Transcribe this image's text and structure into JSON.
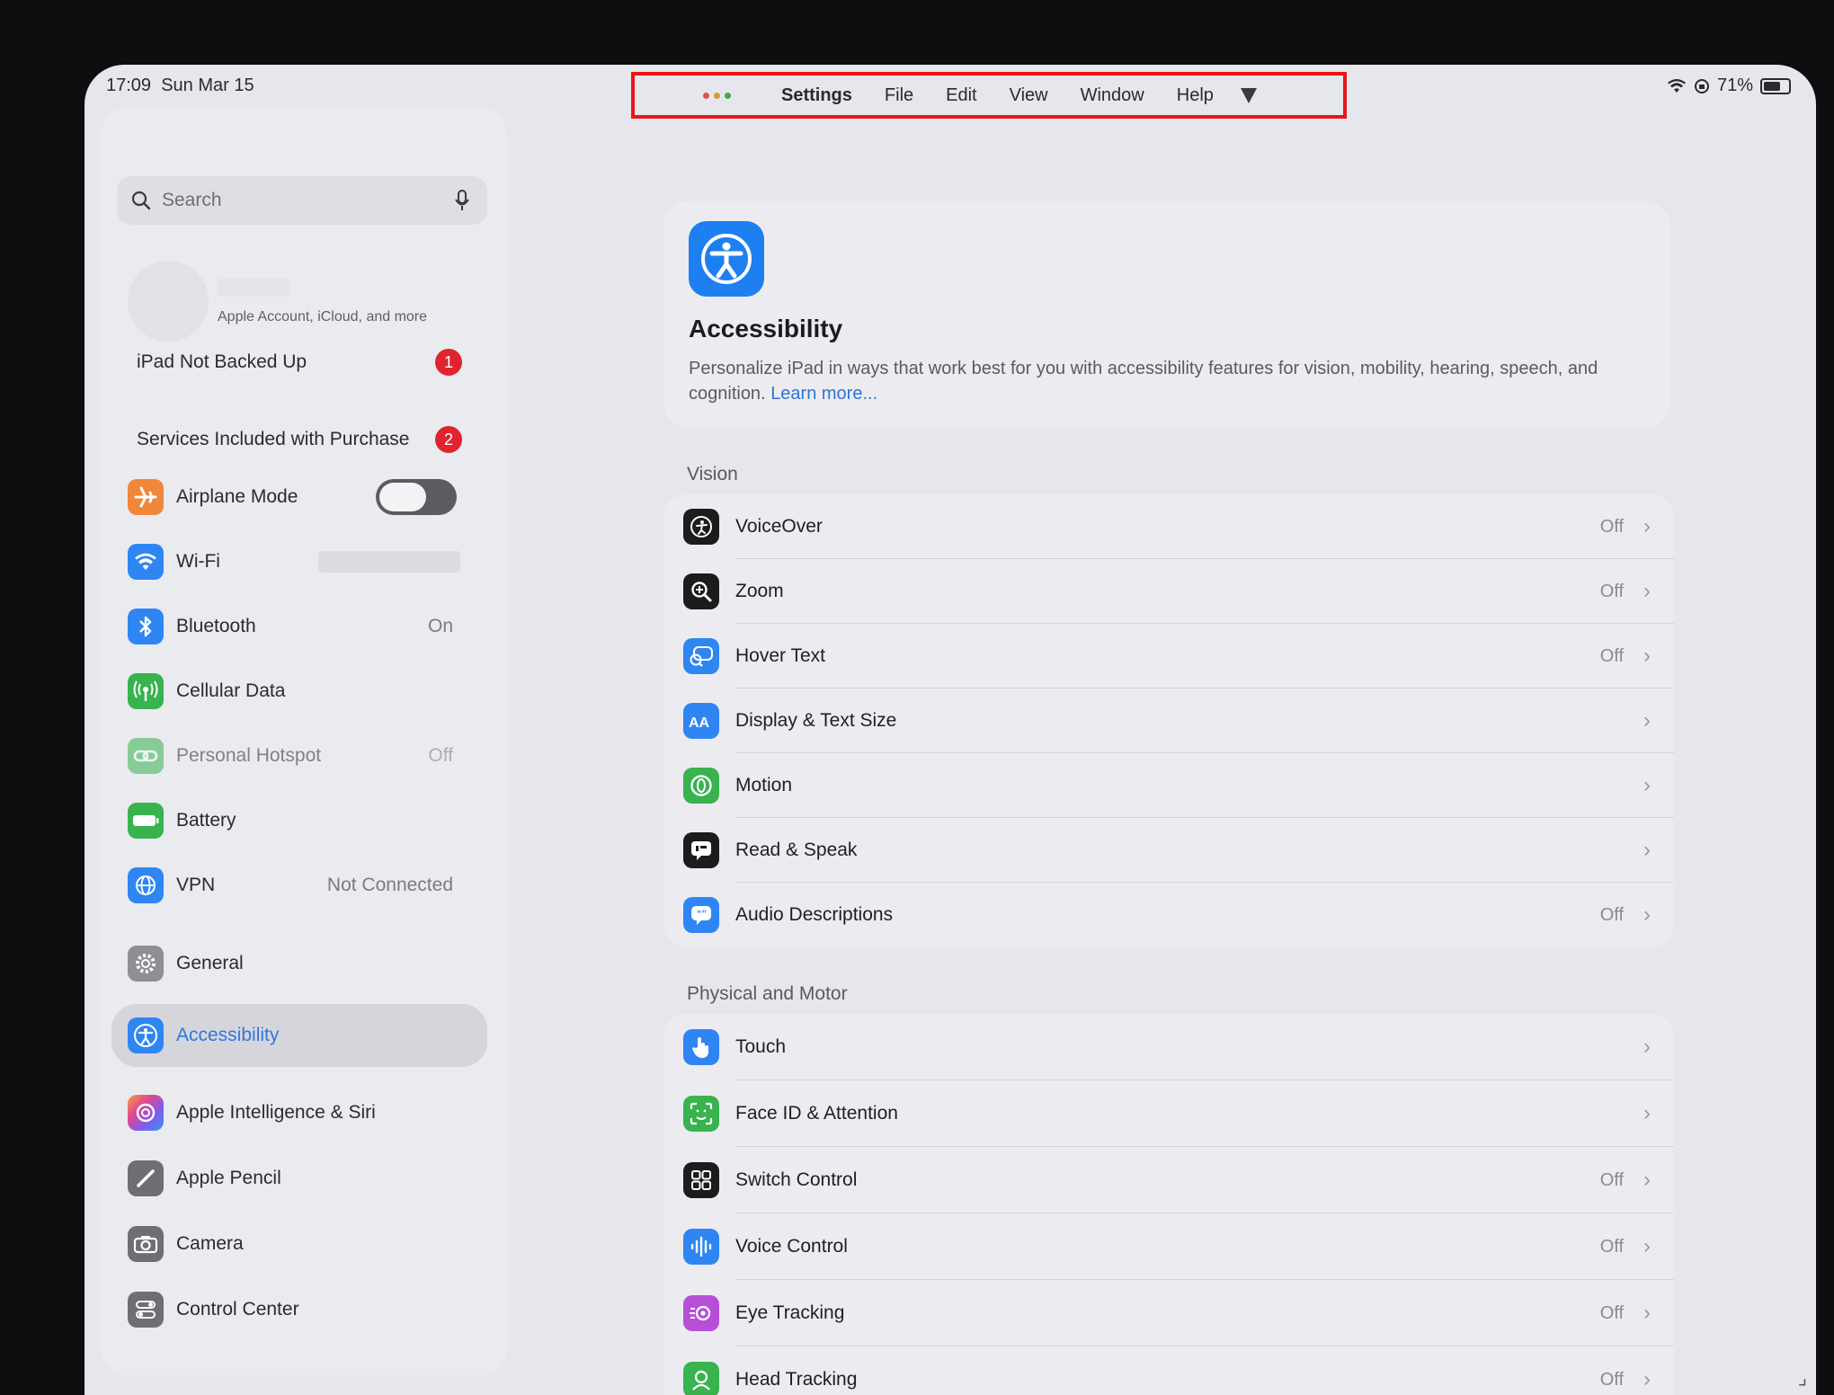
{
  "status": {
    "time": "17:09",
    "date": "Sun Mar 15",
    "battery": "71%",
    "battery_level": 0.71
  },
  "menubar": {
    "app": "Settings",
    "items": [
      "File",
      "Edit",
      "View",
      "Window",
      "Help"
    ]
  },
  "sidebar": {
    "search_placeholder": "Search",
    "account_subtitle": "Apple Account, iCloud, and more",
    "alerts": [
      {
        "label": "iPad Not Backed Up",
        "badge": "1"
      },
      {
        "label": "Services Included with Purchase",
        "badge": "2"
      }
    ],
    "items": [
      {
        "label": "Airplane Mode",
        "icon": "airplane-icon",
        "color": "#f0873a"
      },
      {
        "label": "Wi-Fi",
        "icon": "wifi-icon",
        "color": "#2f86f2"
      },
      {
        "label": "Bluetooth",
        "value": "On",
        "icon": "bluetooth-icon",
        "color": "#2f86f2"
      },
      {
        "label": "Cellular Data",
        "icon": "antenna-icon",
        "color": "#38b34e"
      },
      {
        "label": "Personal Hotspot",
        "value": "Off",
        "icon": "hotspot-icon",
        "color": "#38b34e"
      },
      {
        "label": "Battery",
        "icon": "battery-icon",
        "color": "#38b34e"
      },
      {
        "label": "VPN",
        "value": "Not Connected",
        "icon": "globe-icon",
        "color": "#2f86f2"
      },
      {
        "label": "General",
        "icon": "gear-icon",
        "color": "#8e8e93"
      },
      {
        "label": "Accessibility",
        "icon": "accessibility-icon",
        "color": "#2f86f2"
      },
      {
        "label": "Apple Intelligence & Siri",
        "icon": "siri-icon",
        "color": "#c45fd6"
      },
      {
        "label": "Apple Pencil",
        "icon": "pencil-icon",
        "color": "#6e6e73"
      },
      {
        "label": "Camera",
        "icon": "camera-icon",
        "color": "#6e6e73"
      },
      {
        "label": "Control Center",
        "icon": "toggles-icon",
        "color": "#6e6e73"
      }
    ]
  },
  "header": {
    "title": "Accessibility",
    "description": "Personalize iPad in ways that work best for you with accessibility features for vision, mobility, hearing, speech, and cognition.",
    "link": "Learn more..."
  },
  "vision": {
    "title": "Vision",
    "rows": [
      {
        "label": "VoiceOver",
        "value": "Off",
        "color": "#1c1c1e"
      },
      {
        "label": "Zoom",
        "value": "Off",
        "color": "#1c1c1e"
      },
      {
        "label": "Hover Text",
        "value": "Off",
        "color": "#2f86f2"
      },
      {
        "label": "Display & Text Size",
        "value": "",
        "color": "#2f86f2"
      },
      {
        "label": "Motion",
        "value": "",
        "color": "#38b34e"
      },
      {
        "label": "Read & Speak",
        "value": "",
        "color": "#1c1c1e"
      },
      {
        "label": "Audio Descriptions",
        "value": "Off",
        "color": "#2f86f2"
      }
    ]
  },
  "physical": {
    "title": "Physical and Motor",
    "rows": [
      {
        "label": "Touch",
        "value": "",
        "color": "#2f86f2"
      },
      {
        "label": "Face ID & Attention",
        "value": "",
        "color": "#38b34e"
      },
      {
        "label": "Switch Control",
        "value": "Off",
        "color": "#1c1c1e"
      },
      {
        "label": "Voice Control",
        "value": "Off",
        "color": "#2f86f2"
      },
      {
        "label": "Eye Tracking",
        "value": "Off",
        "color": "#b64fd8"
      },
      {
        "label": "Head Tracking",
        "value": "Off",
        "color": "#38b34e"
      }
    ]
  }
}
